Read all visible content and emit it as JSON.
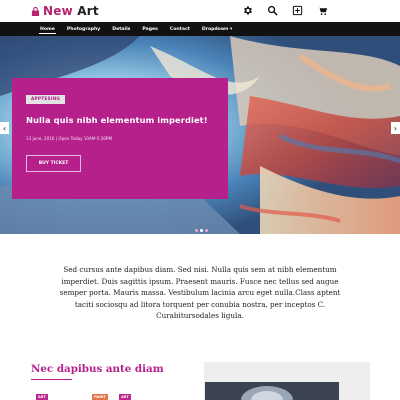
{
  "header": {
    "logo_text_pink": "New",
    "logo_text_dark": "Art",
    "icons": [
      "gear-icon",
      "search-icon",
      "plus-square-icon",
      "cart-icon"
    ]
  },
  "nav": {
    "items": [
      {
        "label": "Home"
      },
      {
        "label": "Photography"
      },
      {
        "label": "Details"
      },
      {
        "label": "Pages"
      },
      {
        "label": "Contact"
      },
      {
        "label": "Dropdown ▾"
      }
    ]
  },
  "hero": {
    "badge": "APPTESING",
    "title": "Nulla quis nibh elementum imperdiet!",
    "date": "13 June, 2016 | Open Today 10AM-5:30PM",
    "button": "BUY TICKET",
    "prev_arrow": "‹",
    "next_arrow": "›",
    "slide_count": 3,
    "active_slide": 1
  },
  "intro": {
    "text": "Sed cursus ante dapibus diam. Sed nisi. Nulla quis sem at nibh elementum imperdiet. Duis sagittis ipsum. Praesent mauris. Fusce nec tellus sed augue semper porta. Mauris massa. Vestibulum lacinia arcu eget nulla.Class aptent taciti sociosqu ad litora torquent per conubia nostra, per inceptos C. Curabitursodales ligula."
  },
  "section": {
    "title": "Nec dapibus ante diam",
    "tags": [
      "ART",
      "PAINT",
      "ART"
    ]
  },
  "colors": {
    "brand": "#b5208b",
    "nav_bg": "#111111"
  }
}
